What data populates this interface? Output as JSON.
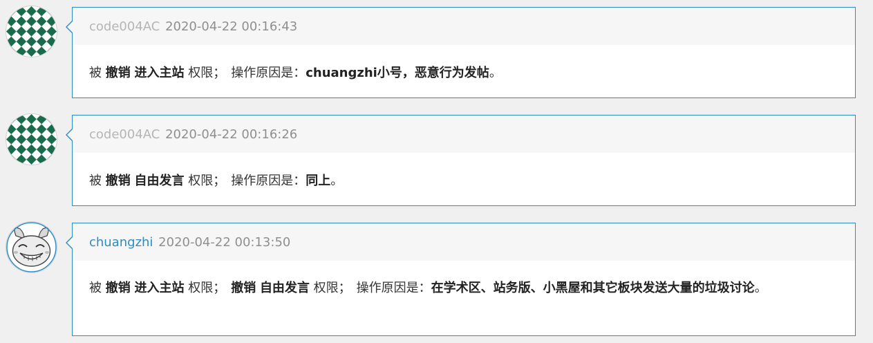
{
  "entries": [
    {
      "username": "code004AC",
      "timestamp": "2020-04-22 00:16:43",
      "message": {
        "prefix": "被",
        "action": "撤销",
        "permission": "进入主站",
        "permission_suffix": "权限；",
        "reason_label": "操作原因是：",
        "reason": "chuangzhi小号，恶意行为发帖",
        "end": "。"
      }
    },
    {
      "username": "code004AC",
      "timestamp": "2020-04-22 00:16:26",
      "message": {
        "prefix": "被",
        "action": "撤销",
        "permission": "自由发言",
        "permission_suffix": "权限；",
        "reason_label": "操作原因是：",
        "reason": "同上",
        "end": "。"
      }
    },
    {
      "username": "chuangzhi",
      "timestamp": "2020-04-22 00:13:50",
      "message": {
        "prefix": "被",
        "action": "撤销",
        "permission": "进入主站",
        "permission_suffix": "权限；",
        "action2": "撤销",
        "permission2": "自由发言",
        "permission2_suffix": "权限；",
        "reason_label": "操作原因是：",
        "reason": "在学术区、站务版、小黑屋和其它板块发送大量的垃圾讨论",
        "end": "。"
      }
    }
  ],
  "colors": {
    "card_border": "#2b8cc4",
    "link": "#2b8cc4",
    "page_bg": "#f0f0f0",
    "card_header_bg": "#f6f6f6",
    "avatar_green": "#1a6b4b"
  },
  "icons": {
    "avatar_1": "green-diamond-pattern-avatar",
    "avatar_2": "green-diamond-pattern-avatar",
    "avatar_3": "cartoon-rabbit-face-avatar"
  }
}
